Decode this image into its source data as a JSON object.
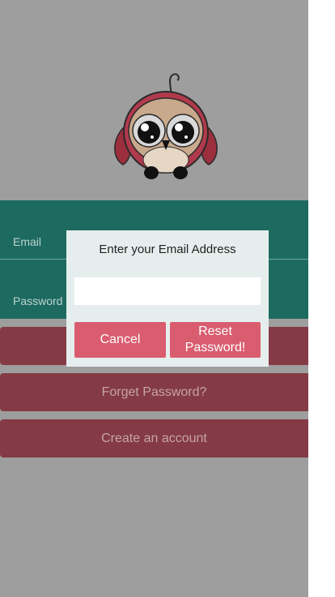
{
  "login": {
    "email_label": "Email",
    "password_label": "Password"
  },
  "buttons": {
    "login_label": "",
    "forget_label": "Forget Password?",
    "create_label": "Create an account"
  },
  "modal": {
    "title": "Enter your Email Address",
    "email_value": "",
    "cancel_label": "Cancel",
    "reset_label": "Reset Password!"
  },
  "colors": {
    "background": "#9e9e9e",
    "panel": "#1d6a60",
    "button": "#843b45",
    "modal_button": "#d95c6f",
    "modal_bg": "#e6eeed"
  },
  "icons": {
    "logo": "owl-logo-icon"
  }
}
